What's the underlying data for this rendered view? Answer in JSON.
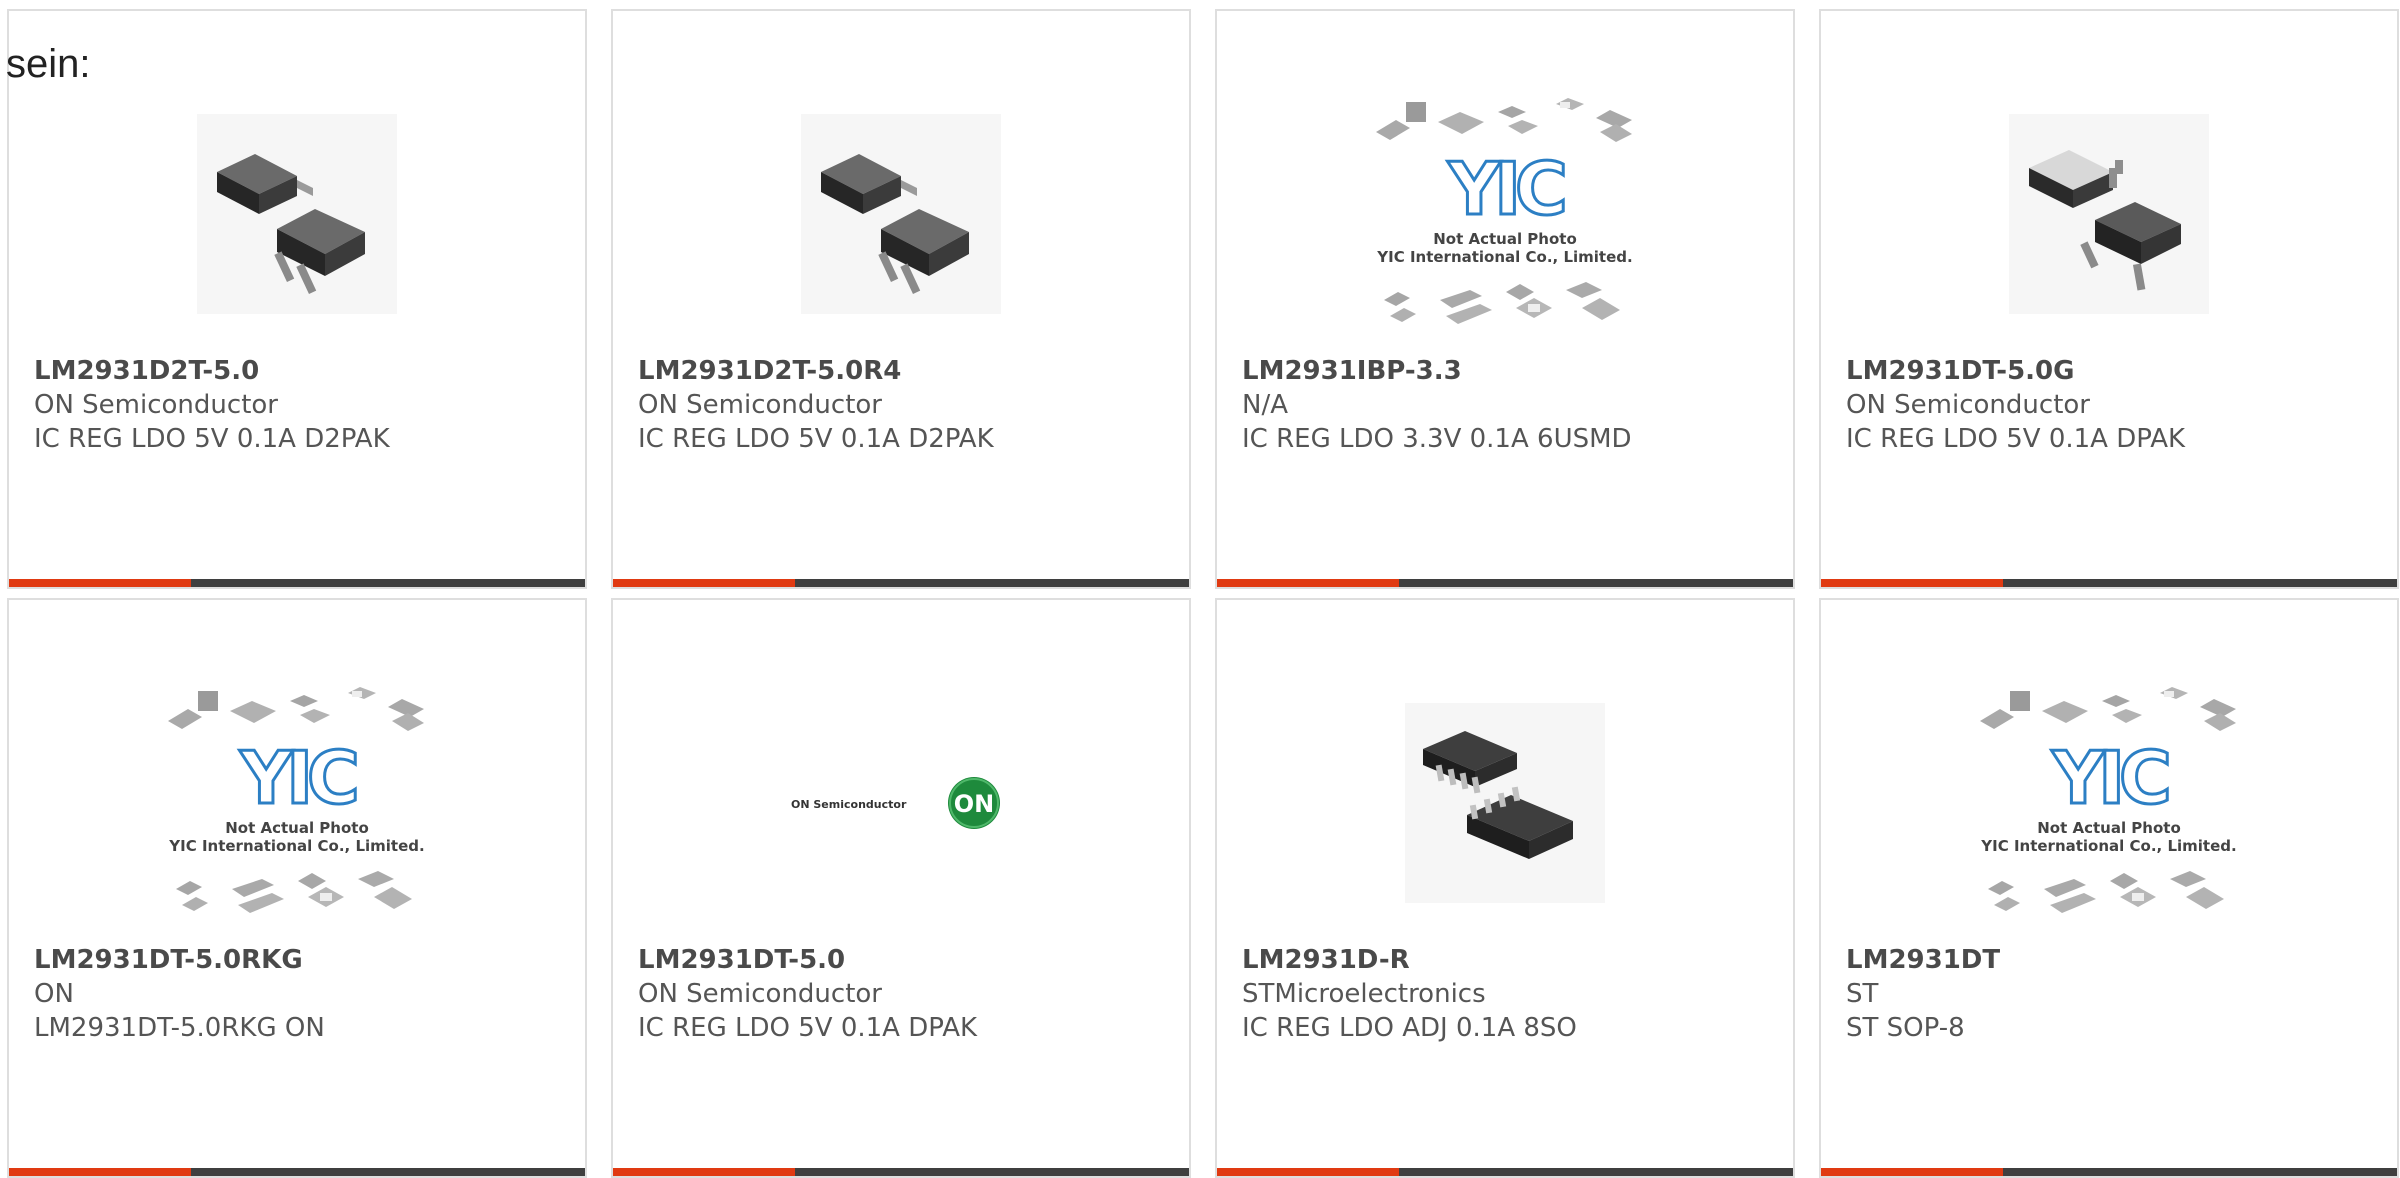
{
  "intro_text": "sein:",
  "colors": {
    "accent": "#e03a12",
    "bar_dark": "#3f3f3f",
    "border": "#dedede",
    "on_green": "#1e8a3c",
    "yic_blue": "#2c7fc4"
  },
  "products": [
    {
      "part_number": "LM2931D2T-5.0",
      "manufacturer": "ON Semiconductor",
      "description": "IC REG LDO 5V 0.1A D2PAK",
      "image": "d2pak-package-icon"
    },
    {
      "part_number": "LM2931D2T-5.0R4",
      "manufacturer": "ON Semiconductor",
      "description": "IC REG LDO 5V 0.1A D2PAK",
      "image": "d2pak-package-icon"
    },
    {
      "part_number": "LM2931IBP-3.3",
      "manufacturer": "N/A",
      "description": "IC REG LDO 3.3V 0.1A 6USMD",
      "image": "yic-placeholder-icon",
      "placeholder_line1": "Not Actual Photo",
      "placeholder_line2": "YIC International Co., Limited."
    },
    {
      "part_number": "LM2931DT-5.0G",
      "manufacturer": "ON Semiconductor",
      "description": "IC REG LDO 5V 0.1A DPAK",
      "image": "dpak-package-icon"
    },
    {
      "part_number": "LM2931DT-5.0RKG",
      "manufacturer": "ON",
      "description": "LM2931DT-5.0RKG ON",
      "image": "yic-placeholder-icon",
      "placeholder_line1": "Not Actual Photo",
      "placeholder_line2": "YIC International Co., Limited."
    },
    {
      "part_number": "LM2931DT-5.0",
      "manufacturer": "ON Semiconductor",
      "description": "IC REG LDO 5V 0.1A DPAK",
      "image": "on-semiconductor-logo",
      "logo_text": "ON Semiconductor",
      "logo_badge": "ON"
    },
    {
      "part_number": "LM2931D-R",
      "manufacturer": "STMicroelectronics",
      "description": "IC REG LDO ADJ 0.1A 8SO",
      "image": "soic8-package-icon"
    },
    {
      "part_number": "LM2931DT",
      "manufacturer": "ST",
      "description": "ST SOP-8",
      "image": "yic-placeholder-icon",
      "placeholder_line1": "Not Actual Photo",
      "placeholder_line2": "YIC International Co., Limited."
    }
  ]
}
